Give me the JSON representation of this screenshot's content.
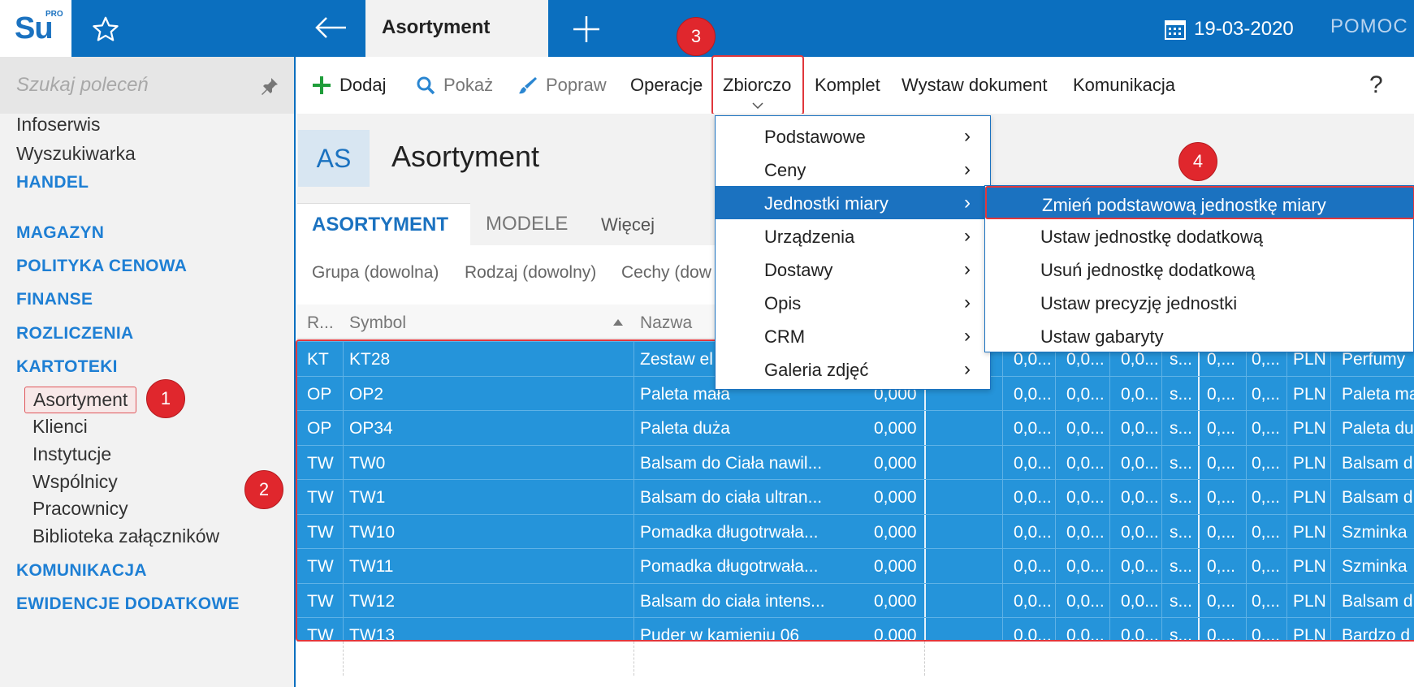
{
  "topbar": {
    "logo_text": "Su",
    "logo_pro": "PRO",
    "active_tab": "Asortyment",
    "date": "19-03-2020",
    "help": "POMOC"
  },
  "sidebar": {
    "search_placeholder": "Szukaj poleceń",
    "items": [
      {
        "label": "Infoserwis"
      },
      {
        "label": "Wyszukiwarka"
      },
      {
        "label": "HANDEL"
      },
      {
        "label": "MAGAZYN"
      },
      {
        "label": "POLITYKA CENOWA"
      },
      {
        "label": "FINANSE"
      },
      {
        "label": "ROZLICZENIA"
      },
      {
        "label": "KARTOTEKI"
      },
      {
        "label": "KOMUNIKACJA"
      },
      {
        "label": "EWIDENCJE DODATKOWE"
      }
    ],
    "kartoteki_sub": [
      {
        "label": "Asortyment"
      },
      {
        "label": "Klienci"
      },
      {
        "label": "Instytucje"
      },
      {
        "label": "Wspólnicy"
      },
      {
        "label": "Pracownicy"
      },
      {
        "label": "Biblioteka załączników"
      }
    ]
  },
  "toolbar": {
    "add": "Dodaj",
    "show": "Pokaż",
    "edit": "Popraw",
    "operations": "Operacje",
    "bulk": "Zbiorczo",
    "set": "Komplet",
    "issue_doc": "Wystaw dokument",
    "communication": "Komunikacja",
    "help": "?"
  },
  "header": {
    "badge": "AS",
    "title": "Asortyment"
  },
  "tabs": [
    "ASORTYMENT",
    "MODELE",
    "Więcej"
  ],
  "filters": [
    "Grupa (dowolna)",
    "Rodzaj (dowolny)",
    "Cechy (dow"
  ],
  "grid": {
    "headers": [
      "R...",
      "Symbol",
      "Nazwa"
    ],
    "rows": [
      {
        "r": "KT",
        "symbol": "KT28",
        "name": "Zestaw el",
        "qty": "",
        "c1": "0,0...",
        "c2": "0,0...",
        "c3": "0,0...",
        "c4": "s...",
        "c5": "0,...",
        "c6": "0,...",
        "cur": "PLN",
        "desc": "Perfumy"
      },
      {
        "r": "OP",
        "symbol": "OP2",
        "name": "Paleta mała",
        "qty": "0,000",
        "c1": "0,0...",
        "c2": "0,0...",
        "c3": "0,0...",
        "c4": "s...",
        "c5": "0,...",
        "c6": "0,...",
        "cur": "PLN",
        "desc": "Paleta ma"
      },
      {
        "r": "OP",
        "symbol": "OP34",
        "name": "Paleta duża",
        "qty": "0,000",
        "c1": "0,0...",
        "c2": "0,0...",
        "c3": "0,0...",
        "c4": "s...",
        "c5": "0,...",
        "c6": "0,...",
        "cur": "PLN",
        "desc": "Paleta du"
      },
      {
        "r": "TW",
        "symbol": "TW0",
        "name": "Balsam do Ciała nawil...",
        "qty": "0,000",
        "c1": "0,0...",
        "c2": "0,0...",
        "c3": "0,0...",
        "c4": "s...",
        "c5": "0,...",
        "c6": "0,...",
        "cur": "PLN",
        "desc": "Balsam d"
      },
      {
        "r": "TW",
        "symbol": "TW1",
        "name": "Balsam do ciała ultran...",
        "qty": "0,000",
        "c1": "0,0...",
        "c2": "0,0...",
        "c3": "0,0...",
        "c4": "s...",
        "c5": "0,...",
        "c6": "0,...",
        "cur": "PLN",
        "desc": "Balsam d"
      },
      {
        "r": "TW",
        "symbol": "TW10",
        "name": "Pomadka długotrwała...",
        "qty": "0,000",
        "c1": "0,0...",
        "c2": "0,0...",
        "c3": "0,0...",
        "c4": "s...",
        "c5": "0,...",
        "c6": "0,...",
        "cur": "PLN",
        "desc": "Szminka"
      },
      {
        "r": "TW",
        "symbol": "TW11",
        "name": "Pomadka długotrwała...",
        "qty": "0,000",
        "c1": "0,0...",
        "c2": "0,0...",
        "c3": "0,0...",
        "c4": "s...",
        "c5": "0,...",
        "c6": "0,...",
        "cur": "PLN",
        "desc": "Szminka"
      },
      {
        "r": "TW",
        "symbol": "TW12",
        "name": "Balsam do ciała intens...",
        "qty": "0,000",
        "c1": "0,0...",
        "c2": "0,0...",
        "c3": "0,0...",
        "c4": "s...",
        "c5": "0,...",
        "c6": "0,...",
        "cur": "PLN",
        "desc": "Balsam d"
      },
      {
        "r": "TW",
        "symbol": "TW13",
        "name": "Puder w kamieniu 06",
        "qty": "0,000",
        "c1": "0,0...",
        "c2": "0,0...",
        "c3": "0,0...",
        "c4": "s...",
        "c5": "0,...",
        "c6": "0,...",
        "cur": "PLN",
        "desc": "Bardzo d"
      }
    ]
  },
  "menu1": {
    "items": [
      {
        "label": "Podstawowe",
        "arrow": "›"
      },
      {
        "label": "Ceny",
        "arrow": "›"
      },
      {
        "label": "Jednostki miary",
        "arrow": "›"
      },
      {
        "label": "Urządzenia",
        "arrow": "›"
      },
      {
        "label": "Dostawy",
        "arrow": "›"
      },
      {
        "label": "Opis",
        "arrow": "›"
      },
      {
        "label": "CRM",
        "arrow": "›"
      },
      {
        "label": "Galeria zdjęć",
        "arrow": "›"
      }
    ]
  },
  "menu2": {
    "items": [
      {
        "label": "Zmień podstawową jednostkę miary"
      },
      {
        "label": "Ustaw jednostkę dodatkową"
      },
      {
        "label": "Usuń jednostkę dodatkową"
      },
      {
        "label": "Ustaw precyzję jednostki"
      },
      {
        "label": "Ustaw gabaryty"
      }
    ]
  },
  "badges": [
    "1",
    "2",
    "3",
    "4"
  ],
  "colors": {
    "brand": "#0b6fbf",
    "selection": "#2594da",
    "highlight_border": "#e0373c"
  }
}
